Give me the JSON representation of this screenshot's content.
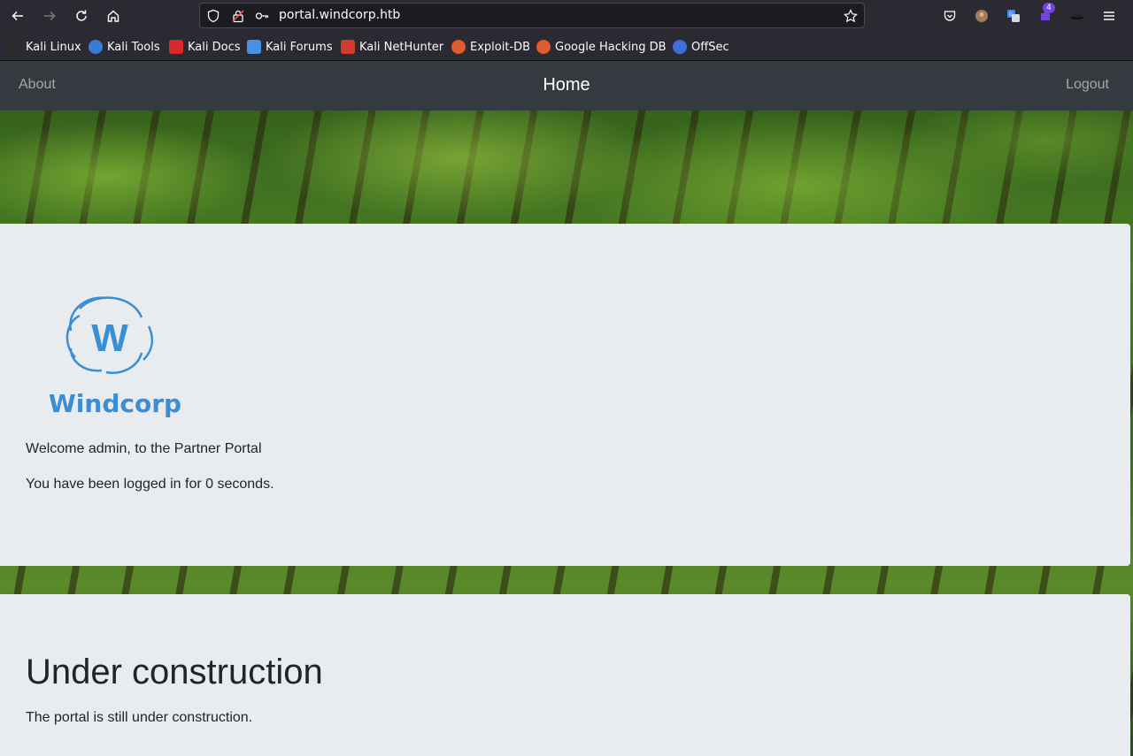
{
  "browser": {
    "url": "portal.windcorp.htb",
    "extension_badge": "4",
    "bookmarks": [
      {
        "label": "Kali Linux",
        "color": "#2a2a2a"
      },
      {
        "label": "Kali Tools",
        "color": "#3a7bd5"
      },
      {
        "label": "Kali Docs",
        "color": "#d62b2b"
      },
      {
        "label": "Kali Forums",
        "color": "#4a90e2"
      },
      {
        "label": "Kali NetHunter",
        "color": "#d23b2b"
      },
      {
        "label": "Exploit-DB",
        "color": "#e05a2b"
      },
      {
        "label": "Google Hacking DB",
        "color": "#e05a2b"
      },
      {
        "label": "OffSec",
        "color": "#3d6fd6"
      }
    ]
  },
  "site": {
    "nav": {
      "about": "About",
      "home": "Home",
      "logout": "Logout"
    },
    "logo_text": "Windcorp",
    "welcome": "Welcome admin, to the Partner Portal",
    "logged_in": "You have been logged in for 0 seconds.",
    "construction_title": "Under construction",
    "construction_text": "The portal is still under construction."
  },
  "colors": {
    "nav_bg": "#343a40",
    "panel_bg": "#e9ecef",
    "logo_blue": "#3a8fd4"
  }
}
